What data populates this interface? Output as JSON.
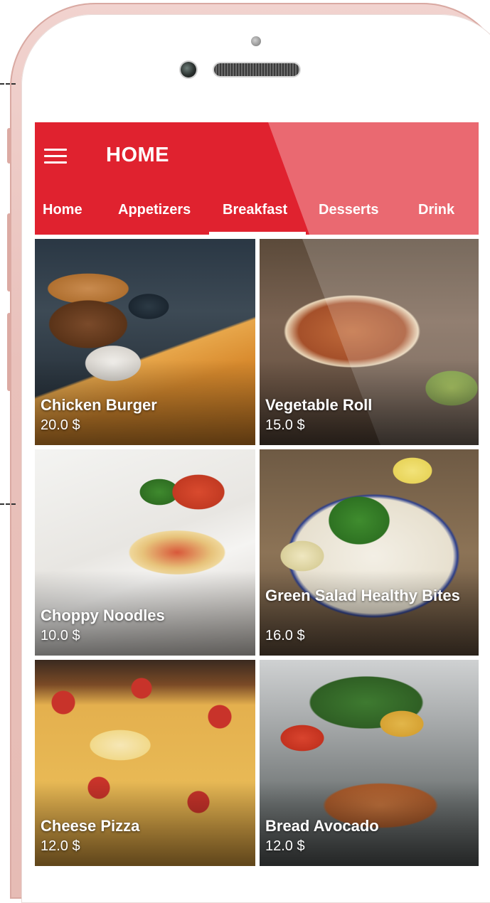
{
  "app": {
    "title": "HOME"
  },
  "tabs": [
    {
      "label": "Home"
    },
    {
      "label": "Appetizers"
    },
    {
      "label": "Breakfast",
      "selected": true
    },
    {
      "label": "Desserts"
    },
    {
      "label": "Drink"
    }
  ],
  "items": [
    {
      "name": "Chicken Burger",
      "price": "20.0 $"
    },
    {
      "name": "Vegetable Roll",
      "price": "15.0 $"
    },
    {
      "name": "Choppy Noodles",
      "price": "10.0 $"
    },
    {
      "name": "Green Salad Healthy Bites",
      "price": "16.0 $"
    },
    {
      "name": "Cheese Pizza",
      "price": "12.0 $"
    },
    {
      "name": "Bread Avocado",
      "price": "12.0 $"
    }
  ],
  "colors": {
    "accent": "#e0222f",
    "frame": "#e9c1bb"
  },
  "icons": {
    "menu": "hamburger-menu-icon"
  }
}
